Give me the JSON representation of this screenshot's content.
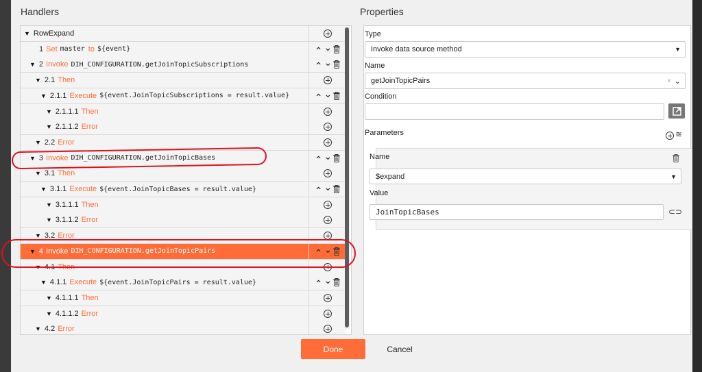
{
  "handlers": {
    "title": "Handlers",
    "rows": [
      {
        "indent": 0,
        "expanded": true,
        "num": "",
        "kw": "",
        "text": "RowExpand",
        "mono": false,
        "actions": "plus"
      },
      {
        "indent": 1,
        "expanded": null,
        "num": "1",
        "kw": "Set",
        "text": "master",
        "kw2": "to",
        "text2": "${event}",
        "mono": true,
        "actions": "move"
      },
      {
        "indent": 1,
        "expanded": true,
        "num": "2",
        "kw": "Invoke",
        "text": "DIH_CONFIGURATION.getJoinTopicSubscriptions",
        "mono": true,
        "actions": "move"
      },
      {
        "indent": 2,
        "expanded": true,
        "num": "2.1",
        "kw": "Then",
        "text": "",
        "mono": false,
        "actions": "plus"
      },
      {
        "indent": 3,
        "expanded": true,
        "num": "2.1.1",
        "kw": "Execute",
        "text": "${event.JoinTopicSubscriptions = result.value}",
        "mono": true,
        "actions": "move"
      },
      {
        "indent": 4,
        "expanded": true,
        "num": "2.1.1.1",
        "kw": "Then",
        "text": "",
        "mono": false,
        "actions": "plus"
      },
      {
        "indent": 4,
        "expanded": true,
        "num": "2.1.1.2",
        "kw": "Error",
        "text": "",
        "mono": false,
        "actions": "plus"
      },
      {
        "indent": 2,
        "expanded": true,
        "num": "2.2",
        "kw": "Error",
        "text": "",
        "mono": false,
        "actions": "plus"
      },
      {
        "indent": 1,
        "expanded": true,
        "num": "3",
        "kw": "Invoke",
        "text": "DIH_CONFIGURATION.getJoinTopicBases",
        "mono": true,
        "actions": "move"
      },
      {
        "indent": 2,
        "expanded": true,
        "num": "3.1",
        "kw": "Then",
        "text": "",
        "mono": false,
        "actions": "plus"
      },
      {
        "indent": 3,
        "expanded": true,
        "num": "3.1.1",
        "kw": "Execute",
        "text": "${event.JoinTopicBases = result.value}",
        "mono": true,
        "actions": "move"
      },
      {
        "indent": 4,
        "expanded": true,
        "num": "3.1.1.1",
        "kw": "Then",
        "text": "",
        "mono": false,
        "actions": "plus"
      },
      {
        "indent": 4,
        "expanded": true,
        "num": "3.1.1.2",
        "kw": "Error",
        "text": "",
        "mono": false,
        "actions": "plus"
      },
      {
        "indent": 2,
        "expanded": true,
        "num": "3.2",
        "kw": "Error",
        "text": "",
        "mono": false,
        "actions": "plus"
      },
      {
        "indent": 1,
        "expanded": true,
        "num": "4",
        "kw": "Invoke",
        "text": "DIH_CONFIGURATION.getJoinTopicPairs",
        "mono": true,
        "actions": "move",
        "selected": true
      },
      {
        "indent": 2,
        "expanded": true,
        "num": "4.1",
        "kw": "Then",
        "text": "",
        "mono": false,
        "actions": "plus"
      },
      {
        "indent": 3,
        "expanded": true,
        "num": "4.1.1",
        "kw": "Execute",
        "text": "${event.JoinTopicPairs = result.value}",
        "mono": true,
        "actions": "move"
      },
      {
        "indent": 4,
        "expanded": true,
        "num": "4.1.1.1",
        "kw": "Then",
        "text": "",
        "mono": false,
        "actions": "plus"
      },
      {
        "indent": 4,
        "expanded": true,
        "num": "4.1.1.2",
        "kw": "Error",
        "text": "",
        "mono": false,
        "actions": "plus"
      },
      {
        "indent": 2,
        "expanded": true,
        "num": "4.2",
        "kw": "Error",
        "text": "",
        "mono": false,
        "actions": "plus"
      }
    ]
  },
  "properties": {
    "title": "Properties",
    "type_label": "Type",
    "type_value": "Invoke data source method",
    "name_label": "Name",
    "name_value": "getJoinTopicPairs",
    "condition_label": "Condition",
    "condition_value": "",
    "parameters_label": "Parameters",
    "param": {
      "name_label": "Name",
      "name_value": "$expand",
      "value_label": "Value",
      "value_value": "JoinTopicBases"
    }
  },
  "footer": {
    "done_label": "Done",
    "cancel_label": "Cancel"
  },
  "colors": {
    "accent": "#ff6c37",
    "annotation": "#e0101c"
  }
}
